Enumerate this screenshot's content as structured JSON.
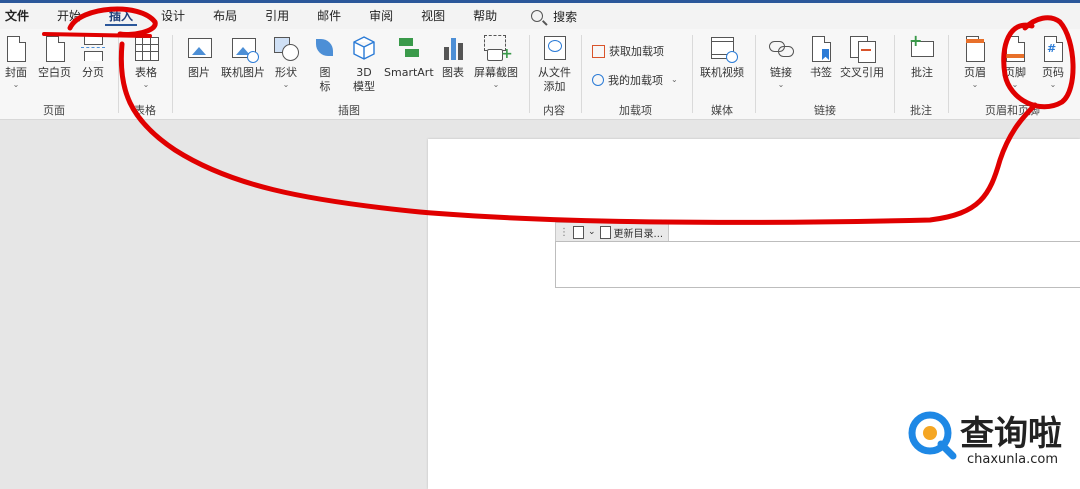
{
  "tabs": [
    "文件",
    "开始",
    "插入",
    "设计",
    "布局",
    "引用",
    "邮件",
    "审阅",
    "视图",
    "帮助"
  ],
  "search_label": "搜索",
  "groups": {
    "page": "页面",
    "table": "表格",
    "illustrations": "插图",
    "content": "内容",
    "addins": "加载项",
    "media": "媒体",
    "links": "链接",
    "comments": "批注",
    "header_footer": "页眉和页脚"
  },
  "buttons": {
    "cover": "封面",
    "blank_page": "空白页",
    "page_break": "分页",
    "table": "表格",
    "picture": "图片",
    "online_picture": "联机图片",
    "shapes": "形状",
    "icons_1": "图",
    "icons_2": "标",
    "model_1": "3D",
    "model_2": "模型",
    "smartart": "SmartArt",
    "chart": "图表",
    "screenshot": "屏幕截图",
    "from_file_1": "从文件",
    "from_file_2": "添加",
    "get_addins": "获取加载项",
    "my_addins": "我的加载项",
    "online_video": "联机视频",
    "link": "链接",
    "bookmark": "书签",
    "cross_ref": "交叉引用",
    "comment": "批注",
    "header": "页眉",
    "footer": "页脚",
    "page_number": "页码"
  },
  "toc": {
    "update": "更新目录..."
  },
  "watermark": {
    "title": "查询啦",
    "url": "chaxunla.com"
  },
  "colors": {
    "accent": "#2b579a",
    "annotation": "#e00000",
    "watermark_blue": "#1e88e5"
  }
}
